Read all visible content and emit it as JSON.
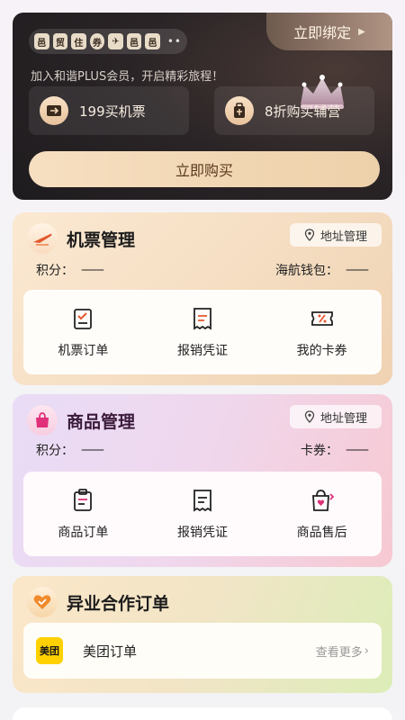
{
  "plus": {
    "bind_label": "立即绑定",
    "slogan": "加入和谐PLUS会员，开启精彩旅程！",
    "badges": [
      "邑",
      "贸",
      "住",
      "券",
      "✈",
      "邑",
      "邑"
    ],
    "benefits": [
      {
        "label": "199买机票",
        "icon": "ticket-icon"
      },
      {
        "label": "8折购买辅营",
        "icon": "luggage-icon"
      }
    ],
    "buy_label": "立即购买",
    "accent": "#f3d8b6"
  },
  "ticket_mgmt": {
    "title": "机票管理",
    "address_label": "地址管理",
    "points_label": "积分：",
    "points_value": "——",
    "wallet_label": "海航钱包：",
    "wallet_value": "——",
    "actions": [
      {
        "label": "机票订单",
        "icon": "ticket-order-icon"
      },
      {
        "label": "报销凭证",
        "icon": "receipt-icon"
      },
      {
        "label": "我的卡券",
        "icon": "coupon-icon"
      }
    ]
  },
  "goods_mgmt": {
    "title": "商品管理",
    "address_label": "地址管理",
    "points_label": "积分：",
    "points_value": "——",
    "coupon_label": "卡券：",
    "coupon_value": "——",
    "actions": [
      {
        "label": "商品订单",
        "icon": "clipboard-icon"
      },
      {
        "label": "报销凭证",
        "icon": "receipt-icon"
      },
      {
        "label": "商品售后",
        "icon": "shopping-bag-heart-icon"
      }
    ]
  },
  "partner": {
    "title": "异业合作订单",
    "rows": [
      {
        "logo": "美团",
        "label": "美团订单",
        "more": "查看更多"
      }
    ]
  }
}
